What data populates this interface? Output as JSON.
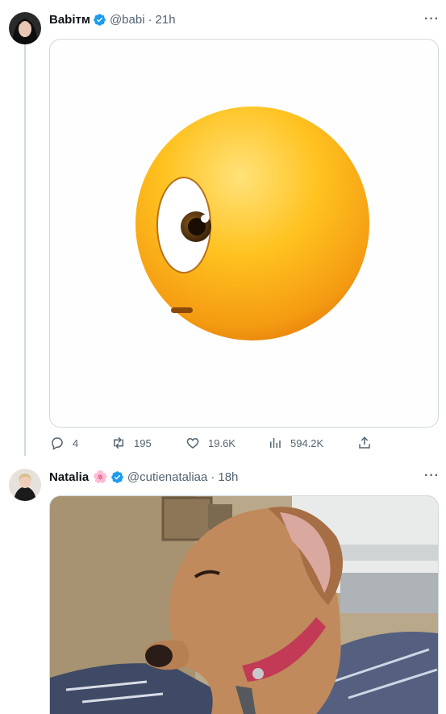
{
  "tweets": [
    {
      "name": "Babiтм",
      "handle": "@babi",
      "time": "21h",
      "media_icon": "eye-emoji-image",
      "actions": {
        "replies": "4",
        "retweets": "195",
        "likes": "19.6K",
        "views": "594.2K"
      }
    },
    {
      "name": "Natalia",
      "flower_emoji": "🌸",
      "handle": "@cutienataliaa",
      "time": "18h",
      "media_icon": "dog-side-eye-image"
    }
  ],
  "separator": "·",
  "more_label": "···",
  "colors": {
    "verified": "#1d9bf0",
    "muted": "#536471",
    "border": "#cfd9de"
  }
}
